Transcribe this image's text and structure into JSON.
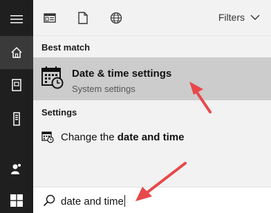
{
  "rail": {
    "items": [
      {
        "icon": "hamburger-menu-icon"
      },
      {
        "icon": "home-icon"
      },
      {
        "icon": "notebook-icon"
      },
      {
        "icon": "tower-icon"
      },
      {
        "icon": "people-icon"
      },
      {
        "icon": "windows-logo-icon"
      }
    ]
  },
  "topbar": {
    "filter_icons": [
      "apps-filter-icon",
      "documents-filter-icon",
      "web-filter-icon"
    ],
    "filters_label": "Filters"
  },
  "results": {
    "best_match_heading": "Best match",
    "best_match": {
      "title": "Date & time settings",
      "subtitle": "System settings",
      "icon": "calendar-clock-icon"
    },
    "settings_heading": "Settings",
    "settings_items": [
      {
        "prefix": "Change the ",
        "bold": "date and time",
        "icon": "calendar-clock-icon"
      }
    ]
  },
  "search": {
    "value": "date and time",
    "icon": "search-icon"
  },
  "colors": {
    "rail_bg": "#1f1f1f",
    "panel_bg": "#f2f2f2",
    "highlight_bg": "#cccccc",
    "annotation_arrow": "#e8484a"
  }
}
